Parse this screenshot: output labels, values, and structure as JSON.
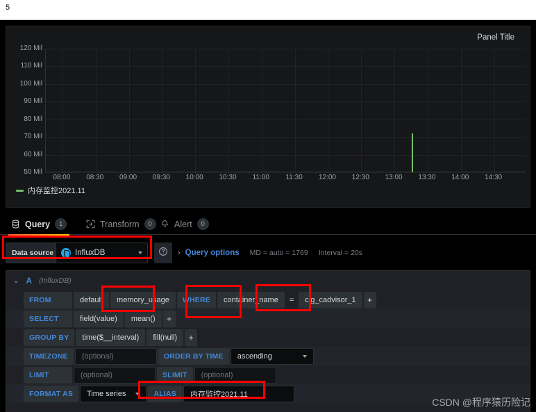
{
  "page": {
    "number": "5"
  },
  "panel": {
    "title": "Panel Title",
    "legend": {
      "label": "内存监控2021.11",
      "color": "#73bf69"
    }
  },
  "chart_data": {
    "type": "line",
    "title": "Panel Title",
    "xlabel": "",
    "ylabel": "",
    "grid": true,
    "legend_position": "bottom-left",
    "series": [
      {
        "name": "内存监控2021.11",
        "color": "#73bf69",
        "points": [
          {
            "x": "13:16",
            "y": 50000000
          },
          {
            "x": "13:16",
            "y": 72000000
          },
          {
            "x": "13:17",
            "y": 50000000
          }
        ]
      }
    ],
    "x_ticks": [
      "08:00",
      "08:30",
      "09:00",
      "09:30",
      "10:00",
      "10:30",
      "11:00",
      "11:30",
      "12:00",
      "12:30",
      "13:00",
      "13:30",
      "14:00",
      "14:30"
    ],
    "y_ticks": [
      "50 Mil",
      "60 Mil",
      "70 Mil",
      "80 Mil",
      "90 Mil",
      "100 Mil",
      "110 Mil",
      "120 Mil"
    ],
    "ylim": [
      50000000,
      120000000
    ],
    "xlim": [
      "08:00",
      "14:45"
    ]
  },
  "tabs": [
    {
      "label": "Query",
      "count": "1",
      "icon": "database-icon",
      "active": true
    },
    {
      "label": "Transform",
      "count": "0",
      "icon": "transform-icon",
      "active": false
    },
    {
      "label": "Alert",
      "count": "0",
      "icon": "bell-icon",
      "active": false
    }
  ],
  "datasource_row": {
    "label": "Data source",
    "selected": "InfluxDB",
    "help_icon": "help-circle-icon",
    "query_options": {
      "chevron": "›",
      "label": "Query options",
      "meta_md": "MD = auto = 1769",
      "meta_interval": "Interval = 20s"
    }
  },
  "query": {
    "ref_id": "A",
    "datasource_note": "(InfluxDB)",
    "rows": {
      "from": {
        "key": "FROM",
        "policy": "default",
        "measurement": "memory_usage",
        "where_key": "WHERE",
        "tag": "container_name",
        "operator": "=",
        "value": "cig_cadvisor_1",
        "plus": "+"
      },
      "select": {
        "key": "SELECT",
        "field": "field(value)",
        "func": "mean()",
        "plus": "+"
      },
      "group_by": {
        "key": "GROUP BY",
        "time": "time($__interval)",
        "fill": "fill(null)",
        "plus": "+"
      },
      "timezone": {
        "key": "TIMEZONE",
        "placeholder": "(optional)",
        "order_key": "ORDER BY TIME",
        "order_value": "ascending"
      },
      "limit": {
        "key": "LIMIT",
        "placeholder": "(optional)",
        "slimit_key": "SLIMIT",
        "slimit_placeholder": "(optional)"
      },
      "format": {
        "key": "FORMAT AS",
        "value": "Time series",
        "alias_key": "ALIAS",
        "alias_value": "内存监控2021.11"
      }
    }
  },
  "annotations": {
    "color": "#ff0000",
    "boxes": [
      {
        "name": "datasource-highlight"
      },
      {
        "name": "measurement-highlight"
      },
      {
        "name": "tag-key-highlight"
      },
      {
        "name": "tag-value-highlight"
      },
      {
        "name": "alias-highlight"
      }
    ]
  },
  "watermark": {
    "text": "CSDN @程序猿历险记"
  }
}
